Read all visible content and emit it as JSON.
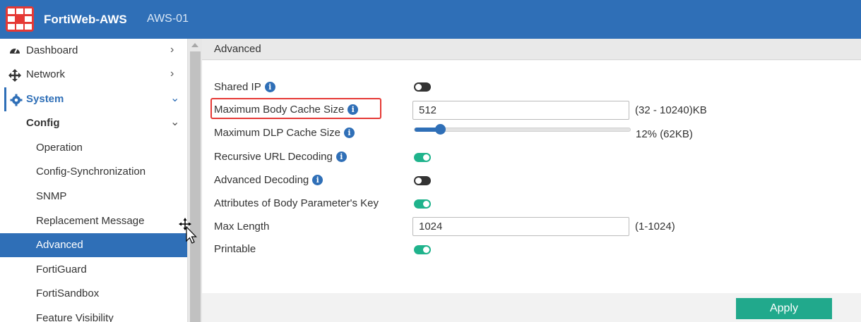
{
  "header": {
    "title": "FortiWeb-AWS",
    "device": "AWS-01"
  },
  "sidebar": {
    "items": [
      {
        "label": "Dashboard",
        "icon": "dashboard-icon"
      },
      {
        "label": "Network",
        "icon": "network-move-icon"
      },
      {
        "label": "System",
        "icon": "gear-icon"
      },
      {
        "label": "Config"
      },
      {
        "label": "Operation"
      },
      {
        "label": "Config-Synchronization"
      },
      {
        "label": "SNMP"
      },
      {
        "label": "Replacement Message"
      },
      {
        "label": "Advanced",
        "selected": true
      },
      {
        "label": "FortiGuard"
      },
      {
        "label": "FortiSandbox"
      },
      {
        "label": "Feature Visibility"
      }
    ]
  },
  "main": {
    "section_title": "Advanced",
    "fields": {
      "shared_ip": {
        "label": "Shared IP",
        "enabled": false
      },
      "max_body_cache": {
        "label": "Maximum Body Cache Size",
        "value": "512",
        "hint": "(32 - 10240)KB"
      },
      "max_dlp_cache": {
        "label": "Maximum DLP Cache Size",
        "percent": 12,
        "hint": "12% (62KB)"
      },
      "recursive_url": {
        "label": "Recursive URL Decoding",
        "enabled": true
      },
      "advanced_decoding": {
        "label": "Advanced Decoding",
        "enabled": false
      },
      "attr_body_param": {
        "label": "Attributes of Body Parameter's Key",
        "enabled": true
      },
      "max_length": {
        "label": "Max Length",
        "value": "1024",
        "hint": "(1-1024)"
      },
      "printable": {
        "label": "Printable",
        "enabled": true
      }
    },
    "apply_label": "Apply"
  },
  "colors": {
    "brand": "#2f6fb7",
    "toggle_on": "#1fb38c",
    "apply": "#21a98c",
    "highlight": "#e53935"
  }
}
